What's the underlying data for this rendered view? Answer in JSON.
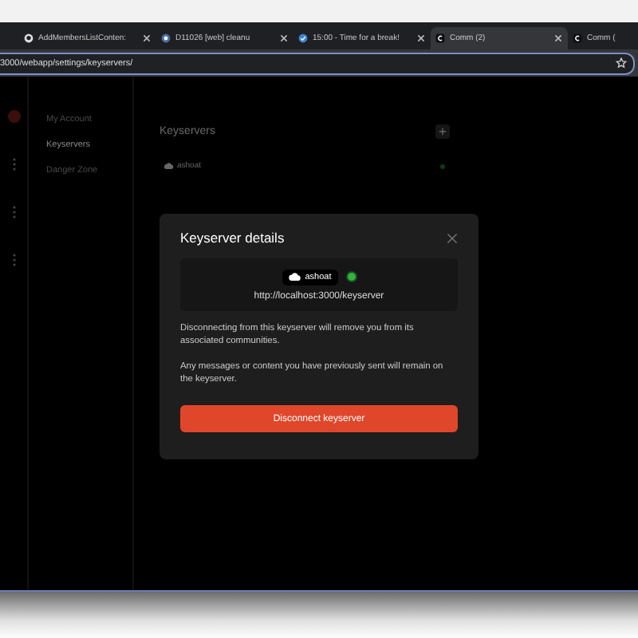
{
  "browser": {
    "tabs": [
      {
        "title": "AddMembersListConten:",
        "kind": "github",
        "selected": false
      },
      {
        "title": "D11026 [web] cleanu",
        "kind": "review",
        "selected": false
      },
      {
        "title": "15:00 - Time for a break!",
        "kind": "check",
        "selected": false
      },
      {
        "title": "Comm (2)",
        "kind": "comm",
        "selected": true
      },
      {
        "title": "Comm (",
        "kind": "comm",
        "selected": false
      }
    ],
    "url": "3000/webapp/settings/keyservers/"
  },
  "sidebar": {
    "items": [
      {
        "label": "My Account",
        "selected": false
      },
      {
        "label": "Keyservers",
        "selected": true
      },
      {
        "label": "Danger Zone",
        "selected": false
      }
    ]
  },
  "panel": {
    "title": "Keyservers",
    "keyservers": [
      {
        "name": "ashoat",
        "online": true
      }
    ]
  },
  "modal": {
    "title": "Keyserver details",
    "keyserver": {
      "name": "ashoat",
      "online": true,
      "url": "http://localhost:3000/keyserver"
    },
    "paragraphs": [
      "Disconnecting from this keyserver will remove you from its associated communities.",
      "Any messages or content you have previously sent will remain on the keyserver."
    ],
    "button": "Disconnect keyserver"
  }
}
